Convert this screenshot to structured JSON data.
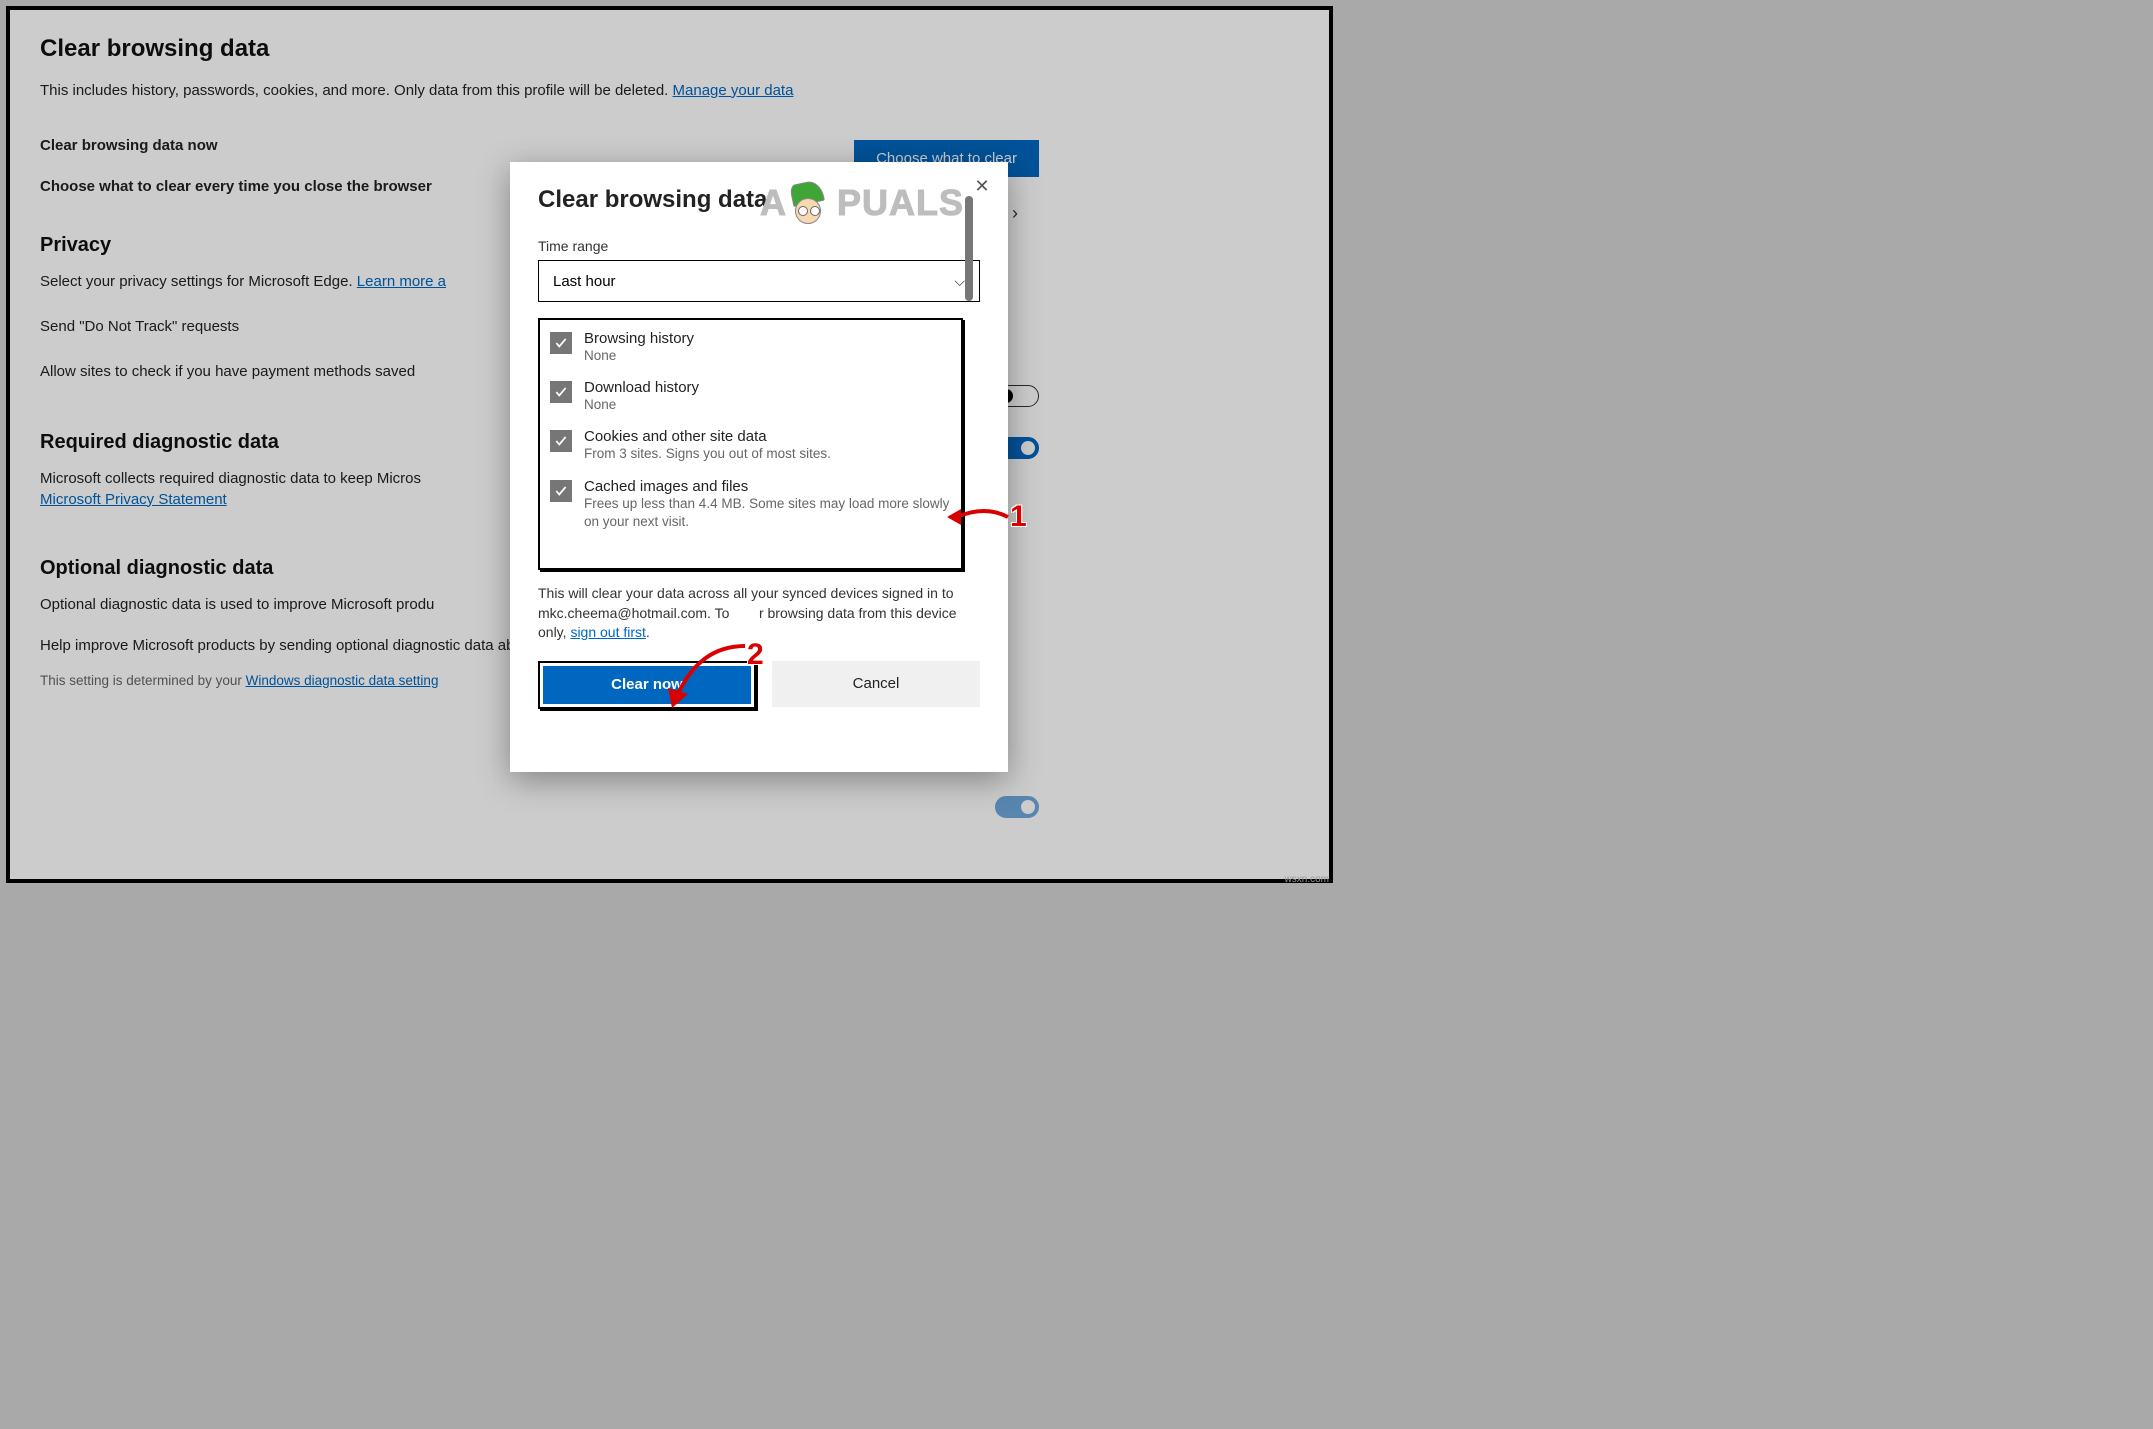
{
  "page": {
    "title": "Clear browsing data",
    "desc_prefix": "This includes history, passwords, cookies, and more. Only data from this profile will be deleted. ",
    "manage_link": "Manage your data",
    "clear_now_label": "Clear browsing data now",
    "choose_button": "Choose what to clear",
    "choose_every_label": "Choose what to clear every time you close the browser",
    "privacy_title": "Privacy",
    "privacy_desc_prefix": "Select your privacy settings for Microsoft Edge. ",
    "privacy_learn": "Learn more a",
    "dnt_label": "Send \"Do Not Track\" requests",
    "payment_label": "Allow sites to check if you have payment methods saved",
    "required_title": "Required diagnostic data",
    "required_desc": "Microsoft collects required diagnostic data to keep Micros",
    "required_link": "Microsoft Privacy Statement",
    "optional_title": "Optional diagnostic data",
    "optional_desc": "Optional diagnostic data is used to improve Microsoft produ",
    "help_label": "Help improve Microsoft products by sending optional diagnostic data about how you use the browser, websites you visit, and crash reports.",
    "footnote_prefix": "This setting is determined by your ",
    "footnote_link": "Windows diagnostic data setting"
  },
  "dialog": {
    "title": "Clear browsing data",
    "time_label": "Time range",
    "time_value": "Last hour",
    "items": [
      {
        "title": "Browsing history",
        "sub": "None"
      },
      {
        "title": "Download history",
        "sub": "None"
      },
      {
        "title": "Cookies and other site data",
        "sub": "From 3 sites. Signs you out of most sites."
      },
      {
        "title": "Cached images and files",
        "sub": "Frees up less than 4.4 MB. Some sites may load more slowly on your next visit."
      }
    ],
    "note_1": "This will clear your data across all your synced devices signed in to mkc.cheema@hotmail.com. To ",
    "note_2": "r browsing data from this device only, ",
    "note_link": "sign out first",
    "clear_btn": "Clear now",
    "cancel_btn": "Cancel"
  },
  "watermark": {
    "left": "A",
    "right": "PUALS"
  },
  "anno": {
    "n1": "1",
    "n2": "2"
  },
  "corner": "wsxn.com"
}
